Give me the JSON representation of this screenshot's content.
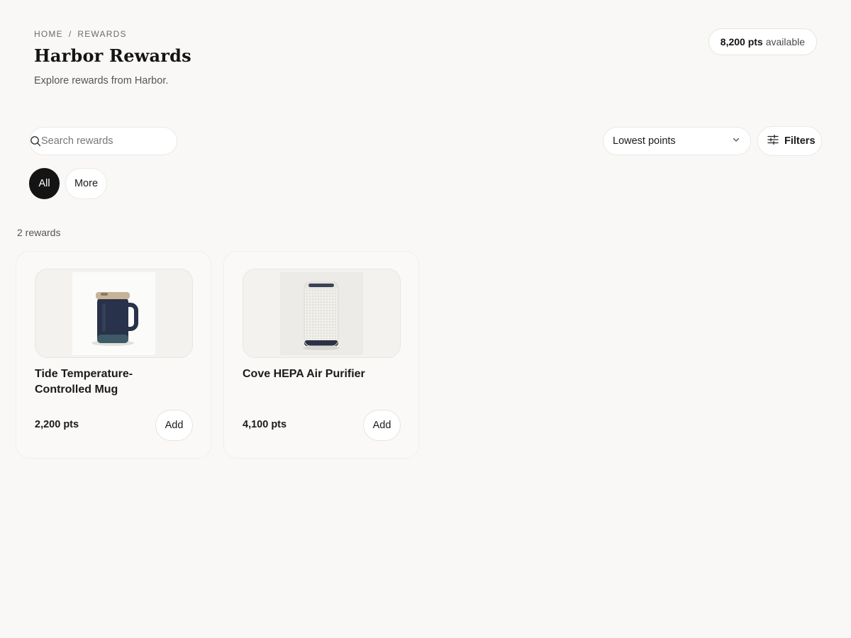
{
  "breadcrumb": {
    "home": "HOME",
    "separator": "/",
    "current": "REWARDS"
  },
  "header": {
    "title": "Harbor Rewards",
    "subtitle": "Explore rewards from Harbor.",
    "points_value": "8,200 pts",
    "points_suffix": "available"
  },
  "search": {
    "placeholder": "Search rewards",
    "value": ""
  },
  "sort": {
    "selected": "Lowest points"
  },
  "filters": {
    "label": "Filters"
  },
  "chips": [
    {
      "label": "All",
      "active": true
    },
    {
      "label": "More",
      "active": false
    }
  ],
  "results": {
    "count_label": "2 rewards"
  },
  "rewards": [
    {
      "name": "Tide Temperature-Controlled Mug",
      "points": "2,200 pts",
      "action": "Add",
      "image": "mug-photo"
    },
    {
      "name": "Cove HEPA Air Purifier",
      "points": "4,100 pts",
      "action": "Add",
      "image": "air-purifier-photo"
    }
  ],
  "icons": {
    "search": "search-icon",
    "sort": "chevron-down-icon",
    "filters": "sliders-icon"
  },
  "colors": {
    "background": "#f9f8f6",
    "active_chip": "#141414",
    "mug_body": "#28324a",
    "mug_lid": "#c7b498"
  }
}
